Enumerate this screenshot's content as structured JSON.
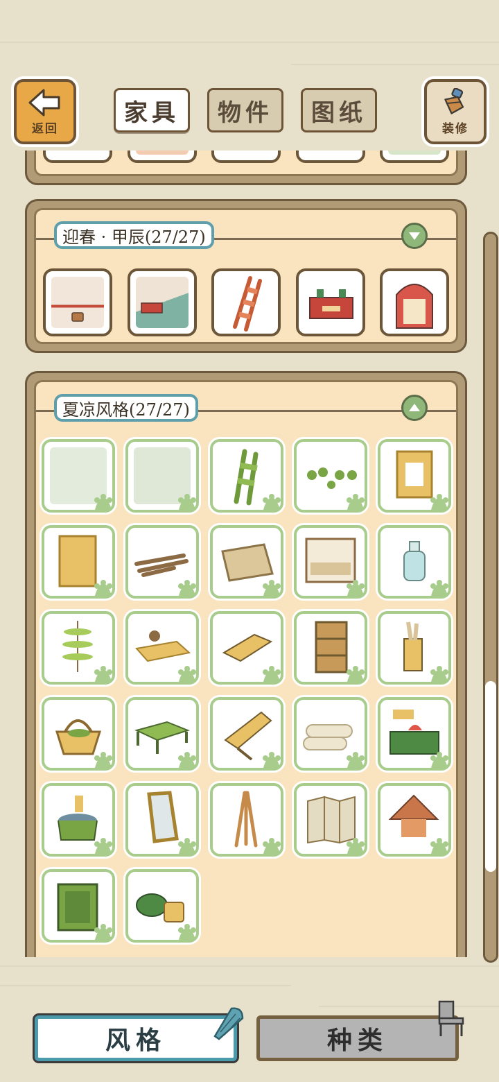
{
  "top": {
    "back_label": "返回",
    "decorate_label": "装修",
    "tabs": [
      {
        "label": "家具",
        "active": true
      },
      {
        "label": "物件",
        "active": false
      },
      {
        "label": "图纸",
        "active": false
      }
    ]
  },
  "sections": [
    {
      "title": "迎春·甲辰(27/27)",
      "title_display": "迎春 · 甲辰(27/27)",
      "state": "collapsed-icon-down",
      "items": [
        "spring-wall",
        "spring-floor",
        "red-ladder",
        "red-bench",
        "red-window"
      ]
    },
    {
      "title_display": "夏凉风格(27/27)",
      "state": "expanded-icon-up",
      "items": [
        "bamboo-wall",
        "bamboo-floor",
        "bamboo-ladder",
        "bamboo-stools",
        "bamboo-window",
        "bamboo-door",
        "bamboo-sticks",
        "bamboo-mat",
        "bamboo-canopy-bed",
        "glass-bottle",
        "leaf-chime",
        "tea-table",
        "bamboo-stool",
        "bamboo-shelf",
        "scroll-stand",
        "bamboo-basket",
        "green-table",
        "lounge-chair",
        "rolled-mats",
        "watermelon-counter",
        "water-bucket",
        "bamboo-mirror",
        "bamboo-tripod",
        "bamboo-screen",
        "thatched-lamp",
        "bamboo-crate",
        "watermelon-basket"
      ]
    }
  ],
  "bottom": {
    "style_label": "风格",
    "kind_label": "种类"
  },
  "colors": {
    "accent_blue": "#4b9bad",
    "panel_cream": "#f9e4bf",
    "wood_brown": "#6d5a3e",
    "leaf_green": "#a7cc8c"
  }
}
